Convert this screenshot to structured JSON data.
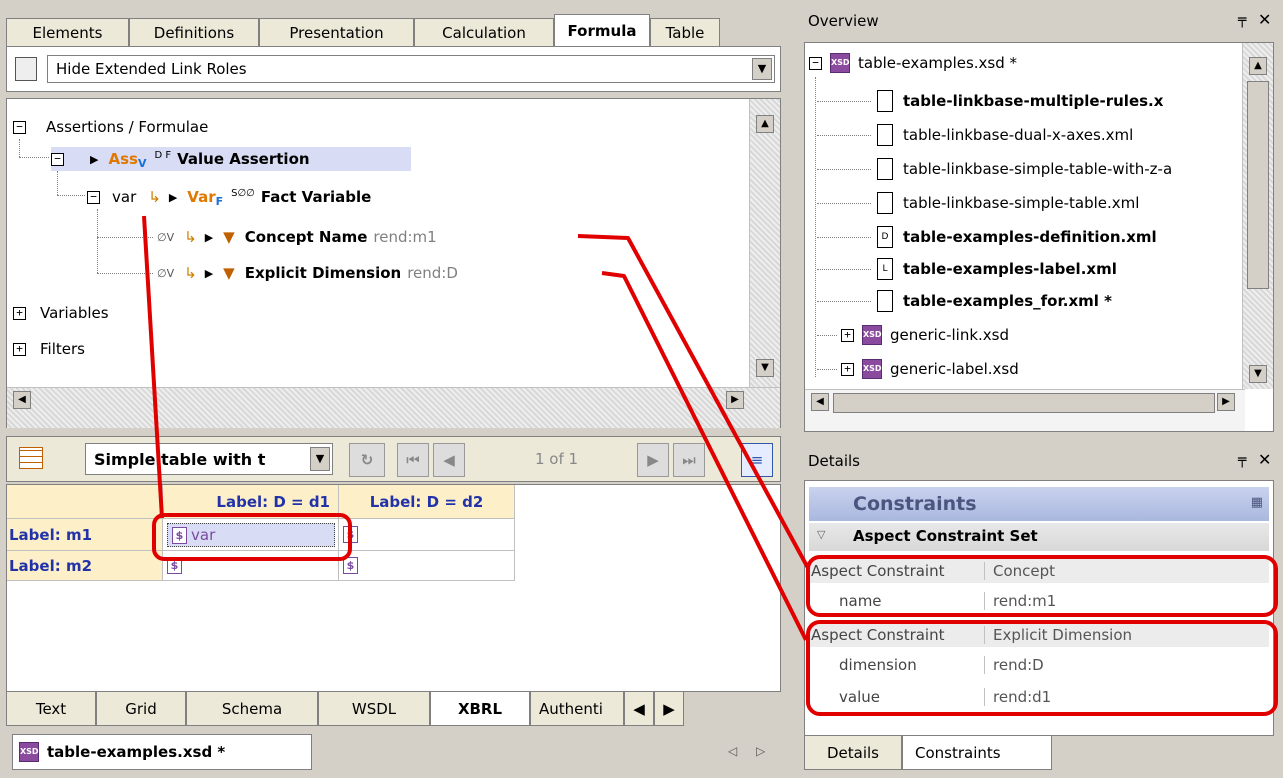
{
  "top_tabs": [
    "Elements",
    "Definitions",
    "Presentation",
    "Calculation",
    "Formula",
    "Table"
  ],
  "active_top_tab": "Formula",
  "role_filter": {
    "value": "Hide Extended Link Roles"
  },
  "tree": {
    "root_label": "Assertions / Formulae",
    "assertion": {
      "prefix": "Ass",
      "sub": "V",
      "flags": "D F",
      "label": "Value Assertion"
    },
    "var_row": {
      "name": "var",
      "prefix": "Var",
      "sub": "F",
      "flags": "S∅∅",
      "label": "Fact Variable"
    },
    "filters": [
      {
        "flags": "∅V",
        "label": "Concept Name",
        "value": "rend:m1"
      },
      {
        "flags": "∅V",
        "label": "Explicit Dimension",
        "value": "rend:D"
      }
    ],
    "variables_label": "Variables",
    "filters_label": "Filters"
  },
  "table_toolbar": {
    "select_value": "Simple table with t",
    "pager": "1 of 1"
  },
  "grid": {
    "col_headers": [
      "Label: D = d1",
      "Label: D = d2"
    ],
    "rows": [
      {
        "label": "Label: m1",
        "cells": [
          "var",
          ""
        ]
      },
      {
        "label": "Label: m2",
        "cells": [
          "",
          ""
        ]
      }
    ],
    "dollar": "$"
  },
  "bottom_tabs": [
    "Text",
    "Grid",
    "Schema",
    "WSDL",
    "XBRL",
    "Authenti"
  ],
  "active_bottom_tab": "XBRL",
  "document_tab": "table-examples.xsd *",
  "overview": {
    "title": "Overview",
    "root": "table-examples.xsd *",
    "files": [
      {
        "name": "table-linkbase-multiple-rules.x",
        "bold": true,
        "icon": ""
      },
      {
        "name": "table-linkbase-dual-x-axes.xml",
        "bold": false,
        "icon": ""
      },
      {
        "name": "table-linkbase-simple-table-with-z-a",
        "bold": false,
        "icon": ""
      },
      {
        "name": "table-linkbase-simple-table.xml",
        "bold": false,
        "icon": ""
      },
      {
        "name": "table-examples-definition.xml",
        "bold": true,
        "icon": "D"
      },
      {
        "name": "table-examples-label.xml",
        "bold": true,
        "icon": "L"
      },
      {
        "name": "table-examples_for.xml *",
        "bold": true,
        "icon": ""
      }
    ],
    "xsd_children": [
      "generic-link.xsd",
      "generic-label.xsd"
    ]
  },
  "details": {
    "title": "Details",
    "header": "Constraints",
    "set_label": "Aspect Constraint Set",
    "groups": [
      {
        "type_label": "Aspect Constraint",
        "type_value": "Concept",
        "props": [
          {
            "k": "name",
            "v": "rend:m1"
          }
        ]
      },
      {
        "type_label": "Aspect Constraint",
        "type_value": "Explicit Dimension",
        "props": [
          {
            "k": "dimension",
            "v": "rend:D"
          },
          {
            "k": "value",
            "v": "rend:d1"
          }
        ]
      }
    ],
    "tabs": [
      "Details",
      "Constraints"
    ],
    "active_tab": "Constraints"
  },
  "pin_glyph": "p",
  "close_glyph": "✕",
  "colors": {
    "accent": "#e07800",
    "highlight": "#d9dcf5",
    "annotation": "#e00000",
    "header_bg": "#fdf0c8"
  }
}
